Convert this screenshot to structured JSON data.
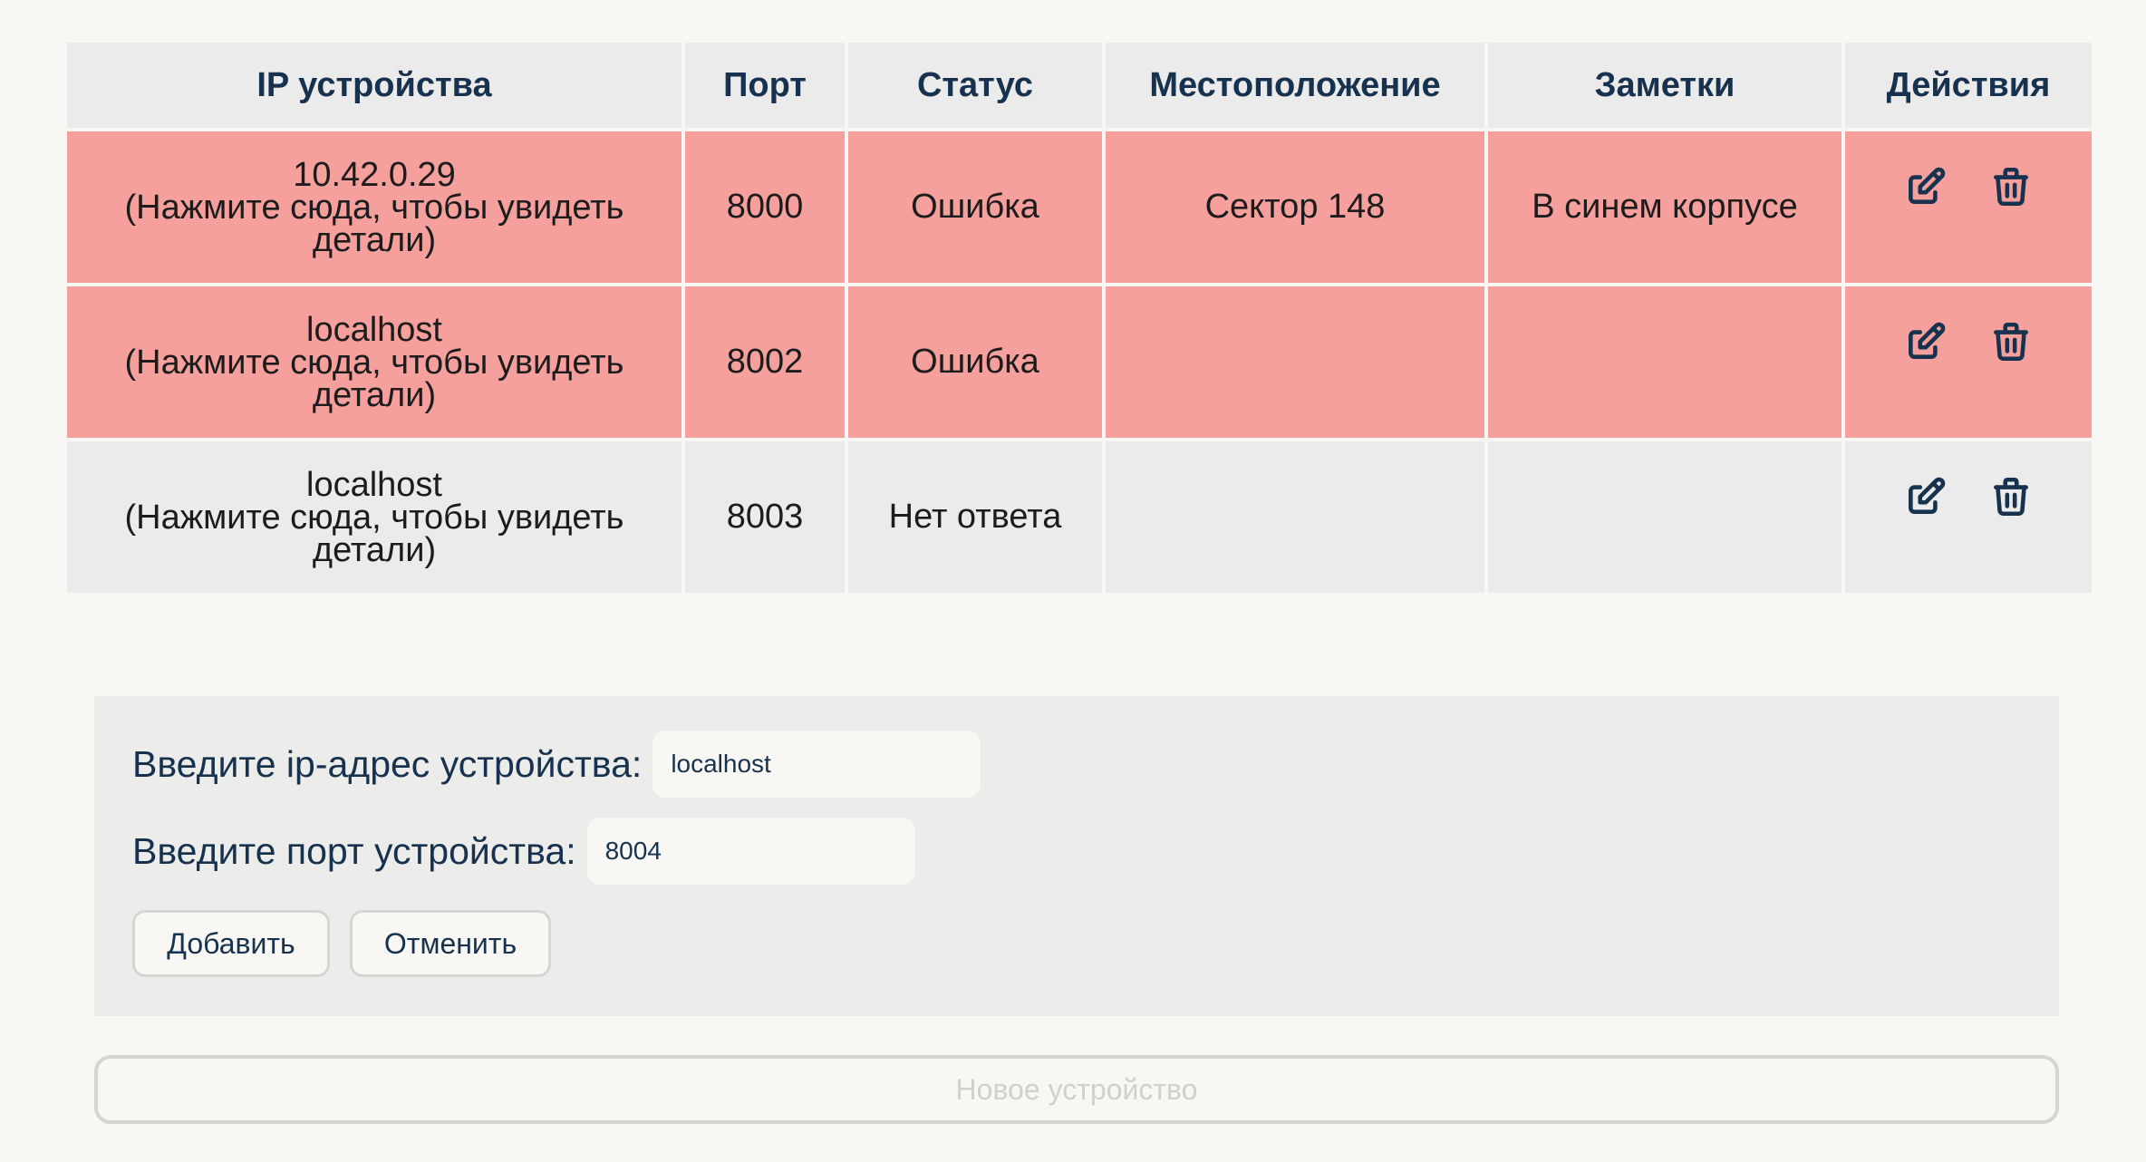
{
  "table": {
    "headers": [
      "IP устройства",
      "Порт",
      "Статус",
      "Местоположение",
      "Заметки",
      "Действия"
    ],
    "rows": [
      {
        "ip": "10.42.0.29",
        "hint_1": "(Нажмите сюда, чтобы увидеть",
        "hint_2": "детали)",
        "port": "8000",
        "status": "Ошибка",
        "location": "Сектор 148",
        "notes": "В синем корпусе"
      },
      {
        "ip": "localhost",
        "hint_1": "(Нажмите сюда, чтобы увидеть",
        "hint_2": "детали)",
        "port": "8002",
        "status": "Ошибка",
        "location": "",
        "notes": ""
      },
      {
        "ip": "localhost",
        "hint_1": "(Нажмите сюда, чтобы увидеть",
        "hint_2": "детали)",
        "port": "8003",
        "status": "Нет ответа",
        "location": "",
        "notes": ""
      }
    ],
    "actions_icons": [
      "edit-icon",
      "trash-icon"
    ]
  },
  "form": {
    "ip_label": "Введите ip-адрес устройства:",
    "ip_value": "localhost",
    "port_label": "Введите порт устройства:",
    "port_value": "8004",
    "add_label": "Добавить",
    "cancel_label": "Отменить"
  },
  "new_device_label": "Новое устройство",
  "colors": {
    "error_row": "#f5a09d",
    "neutral_row": "#ebebeb",
    "header_text": "#17324e",
    "page_bg": "#f8f7f4"
  }
}
